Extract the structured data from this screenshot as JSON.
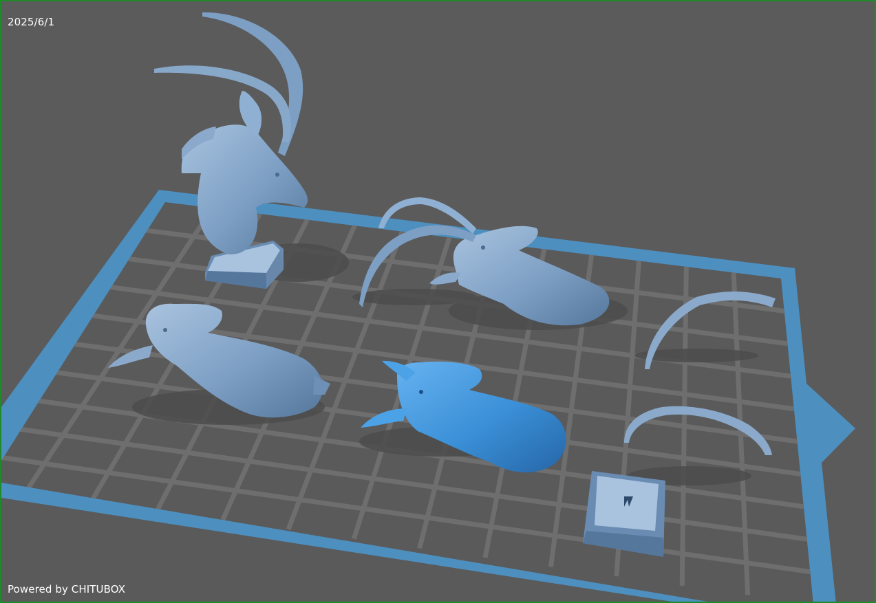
{
  "overlay": {
    "date": "2025/6/1",
    "powered_by": "Powered by CHITUBOX"
  },
  "colors": {
    "background": "#5b5b5b",
    "frame": "#1f8a2a",
    "plate_border": "#4d8fbf",
    "plate_fill": "#5a5a5a",
    "grid": "#6e6e6e",
    "model": "#7d9fc4",
    "model_dark": "#55779c",
    "model_light": "#a9c3df",
    "selected_model": "#3a8fd6",
    "selected_dark": "#2666a8",
    "selected_light": "#66b2f0",
    "shadow": "#4c4c4c"
  },
  "scene": {
    "models": [
      {
        "name": "bust-on-pedestal",
        "selected": false
      },
      {
        "name": "head-horns-top",
        "selected": false
      },
      {
        "name": "head-left",
        "selected": false
      },
      {
        "name": "head-selected",
        "selected": true
      },
      {
        "name": "horn-right-1",
        "selected": false
      },
      {
        "name": "horn-right-2",
        "selected": false
      },
      {
        "name": "pedestal-base",
        "selected": false
      }
    ]
  }
}
